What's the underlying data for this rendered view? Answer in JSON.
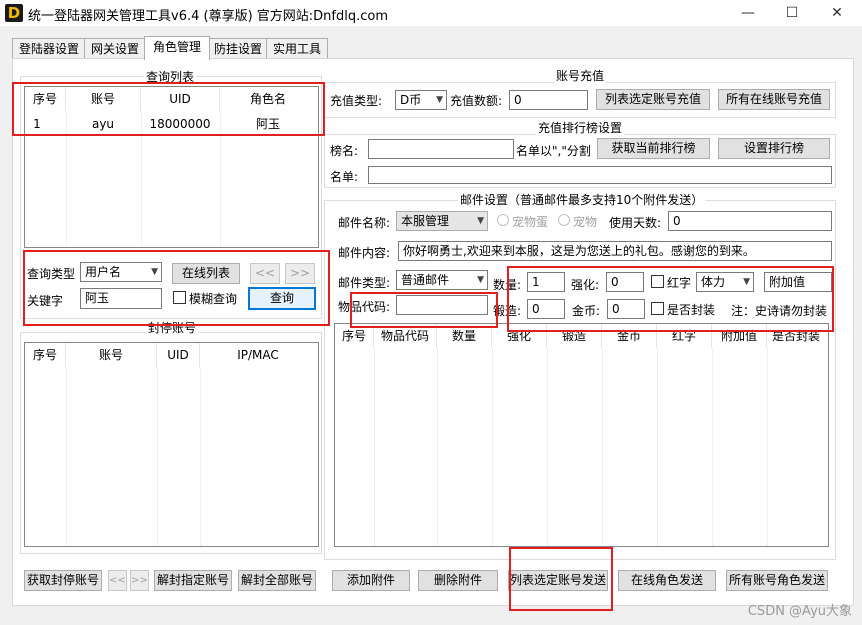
{
  "window": {
    "title": "统一登陆器网关管理工具v6.4 (尊享版)   官方网站:Dnfdlq.com",
    "icon_letter": "D",
    "minimize": "—",
    "maximize": "☐",
    "close": "✕"
  },
  "tabs": [
    {
      "label": "登陆器设置"
    },
    {
      "label": "网关设置"
    },
    {
      "label": "角色管理"
    },
    {
      "label": "防挂设置"
    },
    {
      "label": "实用工具"
    }
  ],
  "query_list": {
    "title": "查询列表",
    "columns": [
      "序号",
      "账号",
      "UID",
      "角色名"
    ],
    "rows": [
      [
        "1",
        "ayu",
        "18000000",
        "阿玉"
      ]
    ]
  },
  "query_controls": {
    "type_label": "查询类型",
    "type_value": "用户名",
    "online_list_button": "在线列表",
    "prev_button": "<<",
    "next_button": ">>",
    "keyword_label": "关键字",
    "keyword_value": "阿玉",
    "fuzzy_label": "模糊查询",
    "search_button": "查询"
  },
  "banned_accounts": {
    "title": "封停账号",
    "columns": [
      "序号",
      "账号",
      "UID",
      "IP/MAC"
    ]
  },
  "recharge": {
    "title": "账号充值",
    "type_label": "充值类型:",
    "type_value": "D币",
    "amount_label": "充值数额:",
    "amount_value": "0",
    "recharge_selected_button": "列表选定账号充值",
    "recharge_online_button": "所有在线账号充值"
  },
  "ranking": {
    "title": "充值排行榜设置",
    "name_label": "榜名:",
    "name_value": "",
    "hint": "名单以\",\"分割",
    "fetch_button": "获取当前排行榜",
    "set_button": "设置排行榜",
    "list_label": "名单:",
    "list_value": ""
  },
  "mail": {
    "title": "邮件设置（普通邮件最多支持10个附件发送）",
    "name_label": "邮件名称:",
    "name_value": "本服管理",
    "pet_egg_label": "宠物蛋",
    "pet_label": "宠物",
    "days_label": "使用天数:",
    "days_value": "0",
    "content_label": "邮件内容:",
    "content_value": "你好啊勇士,欢迎来到本服，这是为您送上的礼包。感谢您的到来。",
    "type_label": "邮件类型:",
    "type_value": "普通邮件",
    "item_code_label": "物品代码:",
    "item_code_value": "",
    "quantity_label": "数量:",
    "quantity_value": "1",
    "enhance_label": "强化:",
    "enhance_value": "0",
    "red_label": "红字",
    "stat_value": "体力",
    "extra_value": "附加值",
    "forge_label": "锻造:",
    "forge_value": "0",
    "gold_label": "金币:",
    "gold_value": "0",
    "sealed_label": "是否封装",
    "note": "注：史诗请勿封装",
    "columns": [
      "序号",
      "物品代码",
      "数量",
      "强化",
      "锻造",
      "金币",
      "红字",
      "附加值",
      "是否封装"
    ]
  },
  "bottom_buttons": {
    "get_banned": "获取封停账号",
    "prev": "<<",
    "next": ">>",
    "unban_selected": "解封指定账号",
    "unban_all": "解封全部账号",
    "add_attachment": "添加附件",
    "delete_attachment": "删除附件",
    "send_selected": "列表选定账号发送",
    "send_online": "在线角色发送",
    "send_all": "所有账号角色发送"
  },
  "watermark": "CSDN @Ayu大象",
  "colors": {
    "highlight": "#e02020",
    "focus": "#0078d7",
    "background": "#f0f0f0"
  }
}
